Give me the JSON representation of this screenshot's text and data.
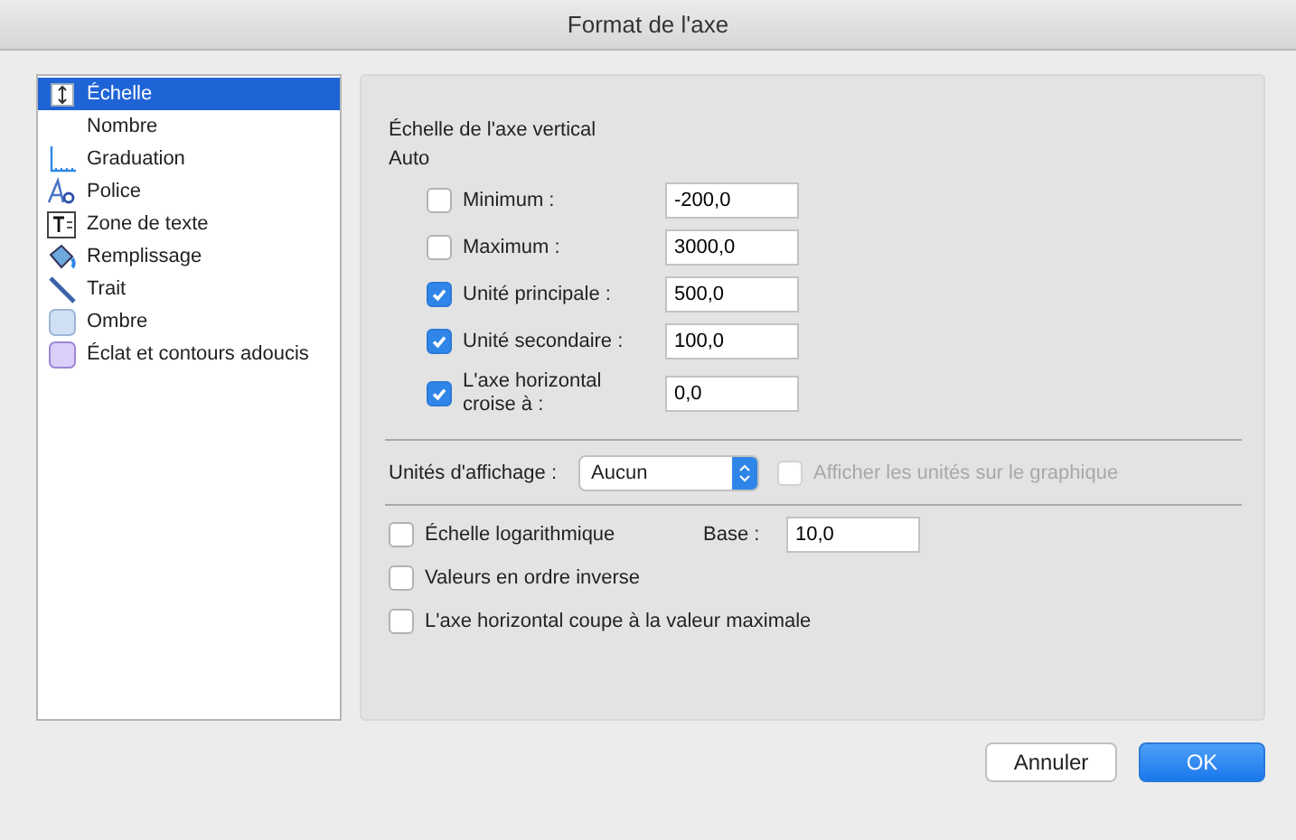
{
  "window": {
    "title": "Format de l'axe"
  },
  "sidebar": {
    "items": [
      {
        "label": "Échelle",
        "selected": true
      },
      {
        "label": "Nombre",
        "selected": false
      },
      {
        "label": "Graduation",
        "selected": false
      },
      {
        "label": "Police",
        "selected": false
      },
      {
        "label": "Zone de texte",
        "selected": false
      },
      {
        "label": "Remplissage",
        "selected": false
      },
      {
        "label": "Trait",
        "selected": false
      },
      {
        "label": "Ombre",
        "selected": false
      },
      {
        "label": "Éclat et contours adoucis",
        "selected": false
      }
    ]
  },
  "scale": {
    "heading": "Échelle de l'axe vertical",
    "auto_label": "Auto",
    "rows": [
      {
        "label": "Minimum :",
        "checked": false,
        "value": "-200,0"
      },
      {
        "label": "Maximum :",
        "checked": false,
        "value": "3000,0"
      },
      {
        "label": "Unité principale :",
        "checked": true,
        "value": "500,0"
      },
      {
        "label": "Unité secondaire :",
        "checked": true,
        "value": "100,0"
      },
      {
        "label": "L'axe horizontal croise à :",
        "checked": true,
        "value": "0,0"
      }
    ]
  },
  "display_units": {
    "label": "Unités d'affichage :",
    "value": "Aucun",
    "show_on_chart": {
      "label": "Afficher les unités sur le graphique",
      "checked": false,
      "disabled": true
    }
  },
  "options": [
    {
      "label": "Échelle logarithmique",
      "checked": false,
      "base_label": "Base :",
      "base_value": "10,0"
    },
    {
      "label": "Valeurs en ordre inverse",
      "checked": false
    },
    {
      "label": "L'axe horizontal coupe à la valeur maximale",
      "checked": false
    }
  ],
  "buttons": [
    {
      "label": "Annuler",
      "primary": false
    },
    {
      "label": "OK",
      "primary": true
    }
  ]
}
